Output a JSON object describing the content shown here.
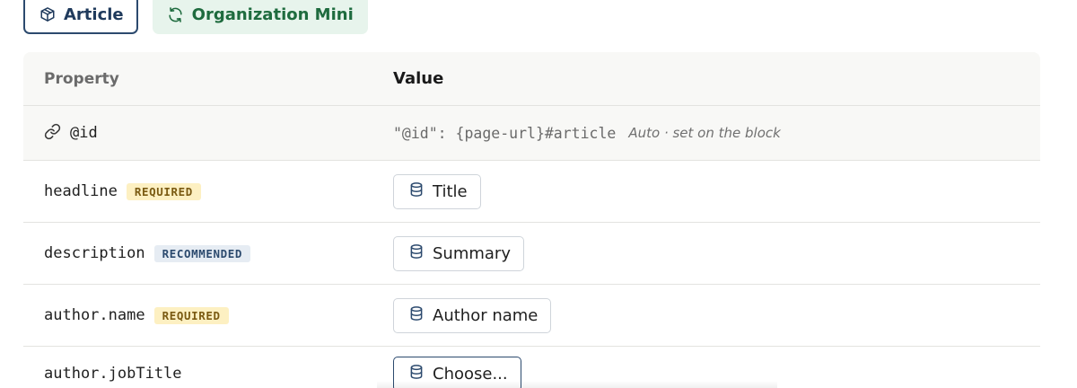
{
  "tabs": [
    {
      "label": "Article",
      "icon": "cube-icon",
      "active": true
    },
    {
      "label": "Organization Mini",
      "icon": "refresh-icon",
      "active": false
    }
  ],
  "table": {
    "header": {
      "property": "Property",
      "value": "Value"
    },
    "auto_row": {
      "property": "@id",
      "icon": "link-icon",
      "code": "\"@id\": {page-url}#article",
      "note": "Auto · set on the block"
    },
    "rows": [
      {
        "property": "headline",
        "badge": "REQUIRED",
        "badge_type": "required",
        "value": "Title",
        "icon": "database-icon"
      },
      {
        "property": "description",
        "badge": "RECOMMENDED",
        "badge_type": "recommended",
        "value": "Summary",
        "icon": "database-icon"
      },
      {
        "property": "author.name",
        "badge": "REQUIRED",
        "badge_type": "required",
        "value": "Author name",
        "icon": "database-icon"
      },
      {
        "property": "author.jobTitle",
        "badge": "",
        "badge_type": "",
        "value": "Choose...",
        "icon": "database-icon"
      }
    ]
  },
  "colors": {
    "active_tab_border": "#2c4a6e",
    "inactive_tab_bg": "#e7f4ec",
    "inactive_tab_text": "#1e6b3e",
    "required_badge_bg": "#fdf0c2",
    "recommended_badge_bg": "#e6ecf3"
  }
}
